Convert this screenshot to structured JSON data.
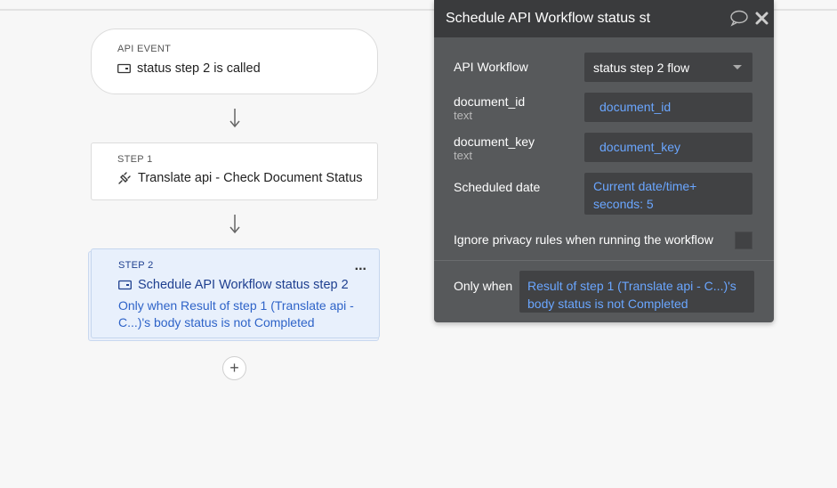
{
  "canvas": {
    "event": {
      "kicker": "API EVENT",
      "title": "status step 2 is called"
    },
    "step1": {
      "kicker": "STEP 1",
      "title": "Translate api - Check Document Status"
    },
    "step2": {
      "kicker": "STEP 2",
      "title": "Schedule API Workflow status step 2",
      "condition": "Only when Result of step 1 (Translate api - C...)'s body status is not Completed",
      "more": "..."
    },
    "add_label": "+"
  },
  "panel": {
    "title": "Schedule API Workflow status st",
    "fields": {
      "api_workflow": {
        "label": "API Workflow",
        "value": "status step 2 flow"
      },
      "document_id": {
        "label": "document_id",
        "type": "text",
        "value": "document_id"
      },
      "document_key": {
        "label": "document_key",
        "type": "text",
        "value": "document_key"
      },
      "scheduled_date": {
        "label": "Scheduled date",
        "value_line1": "Current date/time+",
        "value_line2": "seconds: 5"
      },
      "ignore_privacy": {
        "label": "Ignore privacy rules when running the workflow",
        "checked": false
      },
      "only_when": {
        "label": "Only when",
        "value_line1": "Result of step 1 (Translate api - C...)'s",
        "value_line2": "body status is not Completed"
      }
    }
  },
  "icons": {
    "api_event": "api-icon",
    "step1": "plugin-icon",
    "step2": "api-icon",
    "comment": "comment-icon",
    "close": "close-icon",
    "arrow": "arrow-down-icon",
    "add": "plus-icon"
  },
  "colors": {
    "panel_bg": "#57595b",
    "panel_header": "#3a3b3d",
    "field_bg": "#414244",
    "link": "#6aa6ff",
    "selected_card": "#e8f0fc",
    "selected_title": "#1e3f8f",
    "condition_text": "#2e63c8"
  }
}
